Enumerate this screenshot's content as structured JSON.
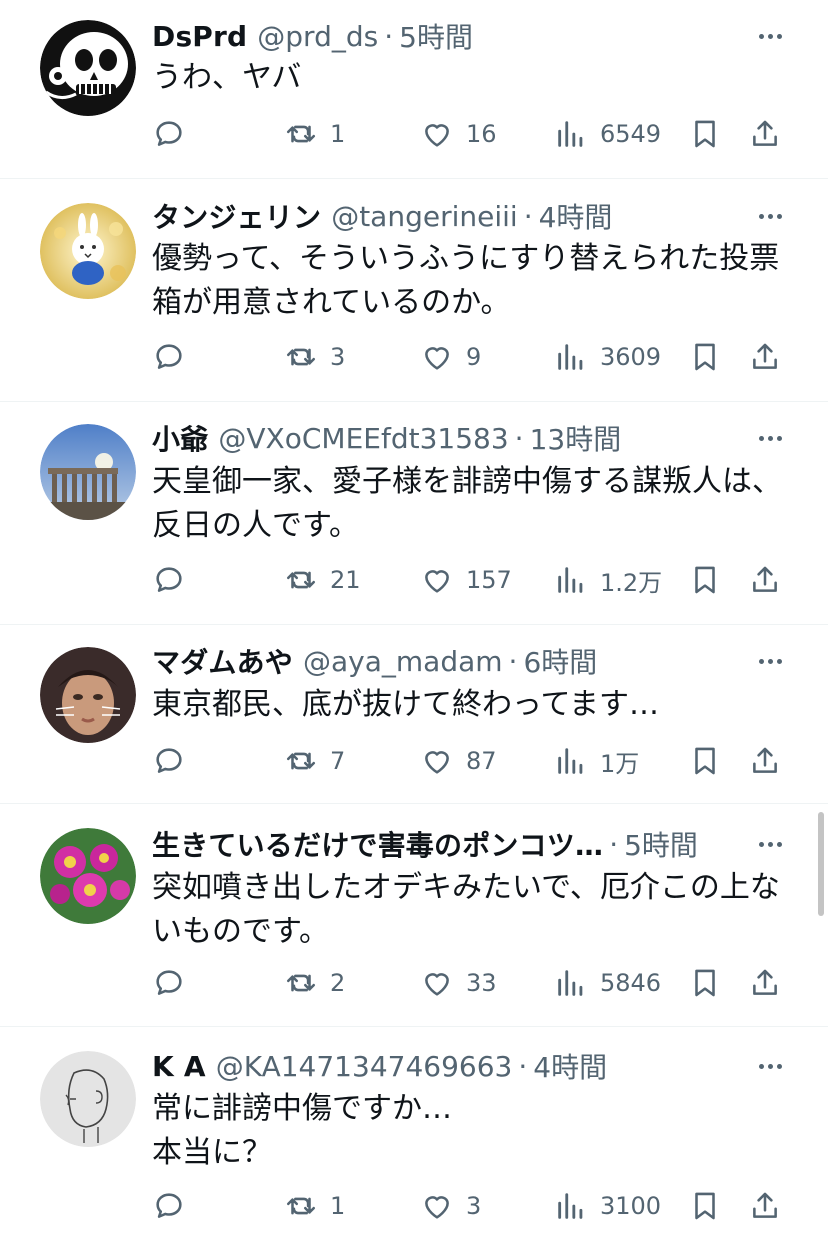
{
  "tweets": [
    {
      "name": "DsPrd",
      "handle": "@prd_ds",
      "separator": "·",
      "time": "5時間",
      "text": "うわ、ヤバ",
      "retweets": "1",
      "likes": "16",
      "views": "6549",
      "avatar": "skull-avatar"
    },
    {
      "name": "タンジェリン",
      "handle": "@tangerineiii",
      "separator": "·",
      "time": "4時間",
      "text": "優勢って、そういうふうにすり替えられた投票\n箱が用意されているのか。",
      "retweets": "3",
      "likes": "9",
      "views": "3609",
      "avatar": "bunny-avatar"
    },
    {
      "name": "小爺",
      "handle": "@VXoCMEEfdt31583",
      "separator": "·",
      "time": "13時間",
      "text": "天皇御一家、愛子様を誹謗中傷する謀叛人は、\n反日の人です。",
      "retweets": "21",
      "likes": "157",
      "views": "1.2万",
      "avatar": "ruins-avatar"
    },
    {
      "name": "マダムあや",
      "handle": "@aya_madam",
      "separator": "·",
      "time": "6時間",
      "text": "東京都民、底が抜けて終わってます…",
      "retweets": "7",
      "likes": "87",
      "views": "1万",
      "avatar": "face-avatar"
    },
    {
      "name": "生きているだけで害毒のポンコツ…",
      "handle": "",
      "separator": "·",
      "time": "5時間",
      "text": "突如噴き出したオデキみたいで、厄介この上な\nいものです。",
      "retweets": "2",
      "likes": "33",
      "views": "5846",
      "avatar": "flowers-avatar"
    },
    {
      "name": "K A",
      "handle": "@KA1471347469663",
      "separator": "·",
      "time": "4時間",
      "text": "常に誹謗中傷ですか…\n本当に？",
      "retweets": "1",
      "likes": "3",
      "views": "3100",
      "avatar": "sketch-avatar"
    }
  ],
  "colors": {
    "text": "#0f1419",
    "muted": "#536471",
    "separator": "#eff3f4",
    "background": "#ffffff"
  }
}
